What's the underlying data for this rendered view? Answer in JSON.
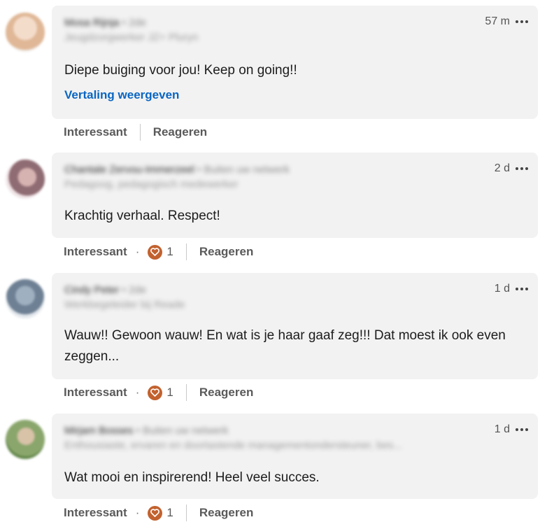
{
  "comments": [
    {
      "author": "Mosa Rijnja",
      "degree": "• 2de",
      "headline": "Jeugdzorgwerker JZ+ Pluryn",
      "time": "57 m",
      "text": "Diepe buiging voor jou! Keep on going!!",
      "translate_label": "Vertaling weergeven",
      "like_label": "Interessant",
      "reaction_count": null,
      "reply_label": "Reageren",
      "avatar_color": "#e8c9b0"
    },
    {
      "author": "Chantale Zervou-Immerzeel",
      "degree": "• Buiten uw netwerk",
      "headline": "Pedagoog, pedagogisch medewerker",
      "time": "2 d",
      "text": "Krachtig verhaal. Respect!",
      "like_label": "Interessant",
      "separator": "·",
      "reaction_count": "1",
      "reply_label": "Reageren",
      "avatar_color": "#c9a3a8"
    },
    {
      "author": "Cindy Peter",
      "degree": "• 2de",
      "headline": "Werkbegeleider bij Reade",
      "time": "1 d",
      "text": "Wauw!! Gewoon wauw! En wat is je haar gaaf zeg!!! Dat moest ik ook even zeggen...",
      "like_label": "Interessant",
      "separator": "·",
      "reaction_count": "1",
      "reply_label": "Reageren",
      "avatar_color": "#8fa2b5"
    },
    {
      "author": "Mirjam Bosses",
      "degree": "• Buiten uw netwerk",
      "headline": "Enthousiaste, ervaren en doortastende managementondersteuner, bes...",
      "time": "1 d",
      "text": "Wat mooi en inspirerend! Heel veel succes.",
      "like_label": "Interessant",
      "separator": "·",
      "reaction_count": "1",
      "reply_label": "Reageren",
      "avatar_color": "#7a9a62"
    }
  ],
  "icons": {
    "more": "more-dots-icon",
    "reaction": "heart-reaction-icon"
  },
  "colors": {
    "link": "#0a66c2",
    "bubble": "#f2f2f2",
    "reaction": "#c2622f"
  }
}
